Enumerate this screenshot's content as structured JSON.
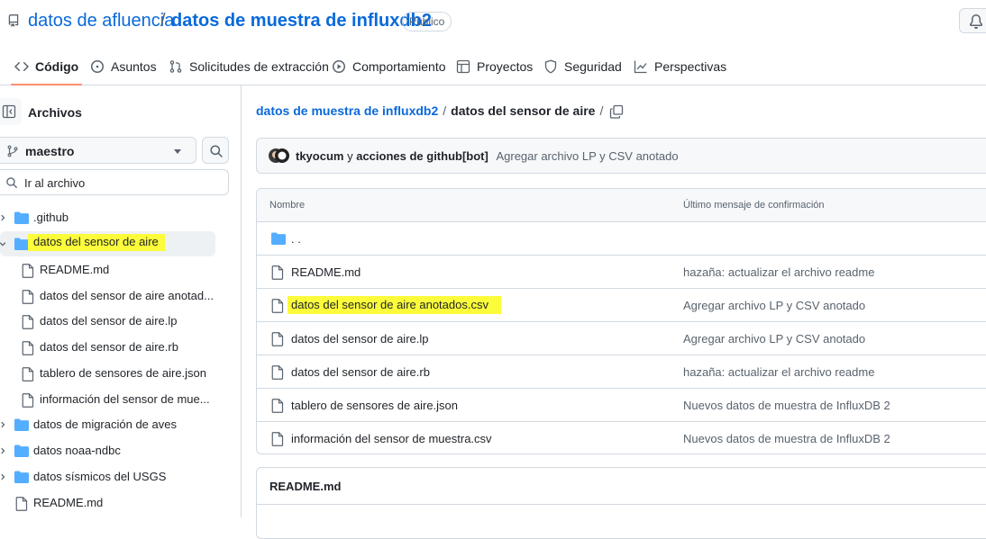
{
  "repo": {
    "owner": "datos de afluencia",
    "separator": "/",
    "name": "datos de muestra de influxdb2",
    "visibility": "Público"
  },
  "tabs": [
    {
      "label": "Código",
      "icon": "code-icon"
    },
    {
      "label": "Asuntos",
      "icon": "issue-opened-icon"
    },
    {
      "label": "Solicitudes de extracción",
      "icon": "git-pull-request-icon"
    },
    {
      "label": "Comportamiento",
      "icon": "play-icon"
    },
    {
      "label": "Proyectos",
      "icon": "table-icon"
    },
    {
      "label": "Seguridad",
      "icon": "shield-icon"
    },
    {
      "label": "Perspectivas",
      "icon": "graph-icon"
    }
  ],
  "sidebar": {
    "title": "Archivos",
    "branch": "maestro",
    "search_placeholder": "Ir al archivo",
    "tree": [
      {
        "label": ".github",
        "type": "folder",
        "expanded": false
      },
      {
        "label": "datos del sensor de aire",
        "type": "folder",
        "expanded": true,
        "selected": true,
        "highlighted": true
      },
      {
        "label": "README.md",
        "type": "file"
      },
      {
        "label": "datos del sensor de aire anotad...",
        "type": "file"
      },
      {
        "label": "datos del sensor de aire.lp",
        "type": "file"
      },
      {
        "label": "datos del sensor de aire.rb",
        "type": "file"
      },
      {
        "label": "tablero de sensores de aire.json",
        "type": "file"
      },
      {
        "label": "información del sensor de mue...",
        "type": "file"
      },
      {
        "label": "datos de migración de aves",
        "type": "folder",
        "expanded": false
      },
      {
        "label": "datos noaa-ndbc",
        "type": "folder",
        "expanded": false
      },
      {
        "label": "datos sísmicos del USGS",
        "type": "folder",
        "expanded": false
      },
      {
        "label": "README.md",
        "type": "file"
      }
    ]
  },
  "breadcrumb": {
    "root": "datos de muestra de influxdb2",
    "separator": "/",
    "current": "datos del sensor de aire",
    "trailing": "/"
  },
  "commit": {
    "author": "tkyocum",
    "conjunction": "y",
    "coauthor": "acciones de github[bot]",
    "message": "Agregar archivo LP y CSV anotado"
  },
  "files": {
    "header_name": "Nombre",
    "header_message": "Último mensaje de confirmación",
    "parent_label": ". .",
    "rows": [
      {
        "name": "README.md",
        "message": "hazaña: actualizar el archivo readme"
      },
      {
        "name": "datos del sensor de aire anotados.csv",
        "message": "Agregar archivo LP y CSV anotado",
        "highlighted": true
      },
      {
        "name": "datos del sensor de aire.lp",
        "message": "Agregar archivo LP y CSV anotado"
      },
      {
        "name": "datos del sensor de aire.rb",
        "message": "hazaña: actualizar el archivo readme"
      },
      {
        "name": "tablero de sensores de aire.json",
        "message": "Nuevos datos de muestra de InfluxDB 2"
      },
      {
        "name": "información del sensor de muestra.csv",
        "message": "Nuevos datos de muestra de InfluxDB 2"
      }
    ]
  },
  "readme": {
    "title": "README.md"
  },
  "colors": {
    "link": "#0969da",
    "folder": "#54aeff",
    "highlight": "#fcfc3a",
    "tab_underline": "#fd8c73"
  }
}
